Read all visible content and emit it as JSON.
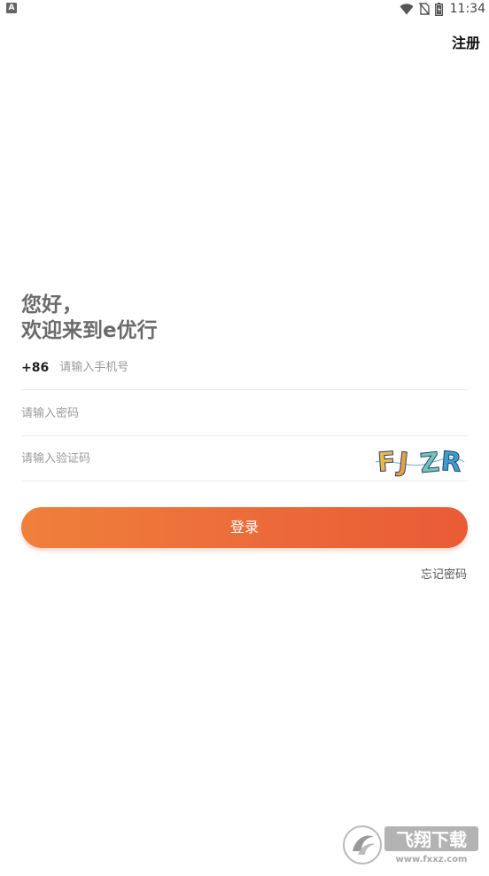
{
  "status_bar": {
    "app_badge": "A",
    "time": "11:34",
    "icons": [
      "wifi-icon",
      "no-sim-icon",
      "battery-icon"
    ]
  },
  "header": {
    "register_label": "注册"
  },
  "greeting": {
    "line1": "您好，",
    "line2": "欢迎来到e优行"
  },
  "form": {
    "phone": {
      "country_code": "+86",
      "placeholder": "请输入手机号",
      "value": ""
    },
    "password": {
      "placeholder": "请输入密码",
      "value": ""
    },
    "captcha": {
      "placeholder": "请输入验证码",
      "value": "",
      "image_text": "FJZR"
    }
  },
  "login_button_label": "登录",
  "forgot_password_label": "忘记密码",
  "watermark": {
    "brand": "飞翔下载",
    "url": "www.fxxz.com"
  },
  "colors": {
    "accent_start": "#ef803a",
    "accent_end": "#e95b36",
    "greeting_text": "#6b6b6b",
    "divider": "#ececec"
  }
}
